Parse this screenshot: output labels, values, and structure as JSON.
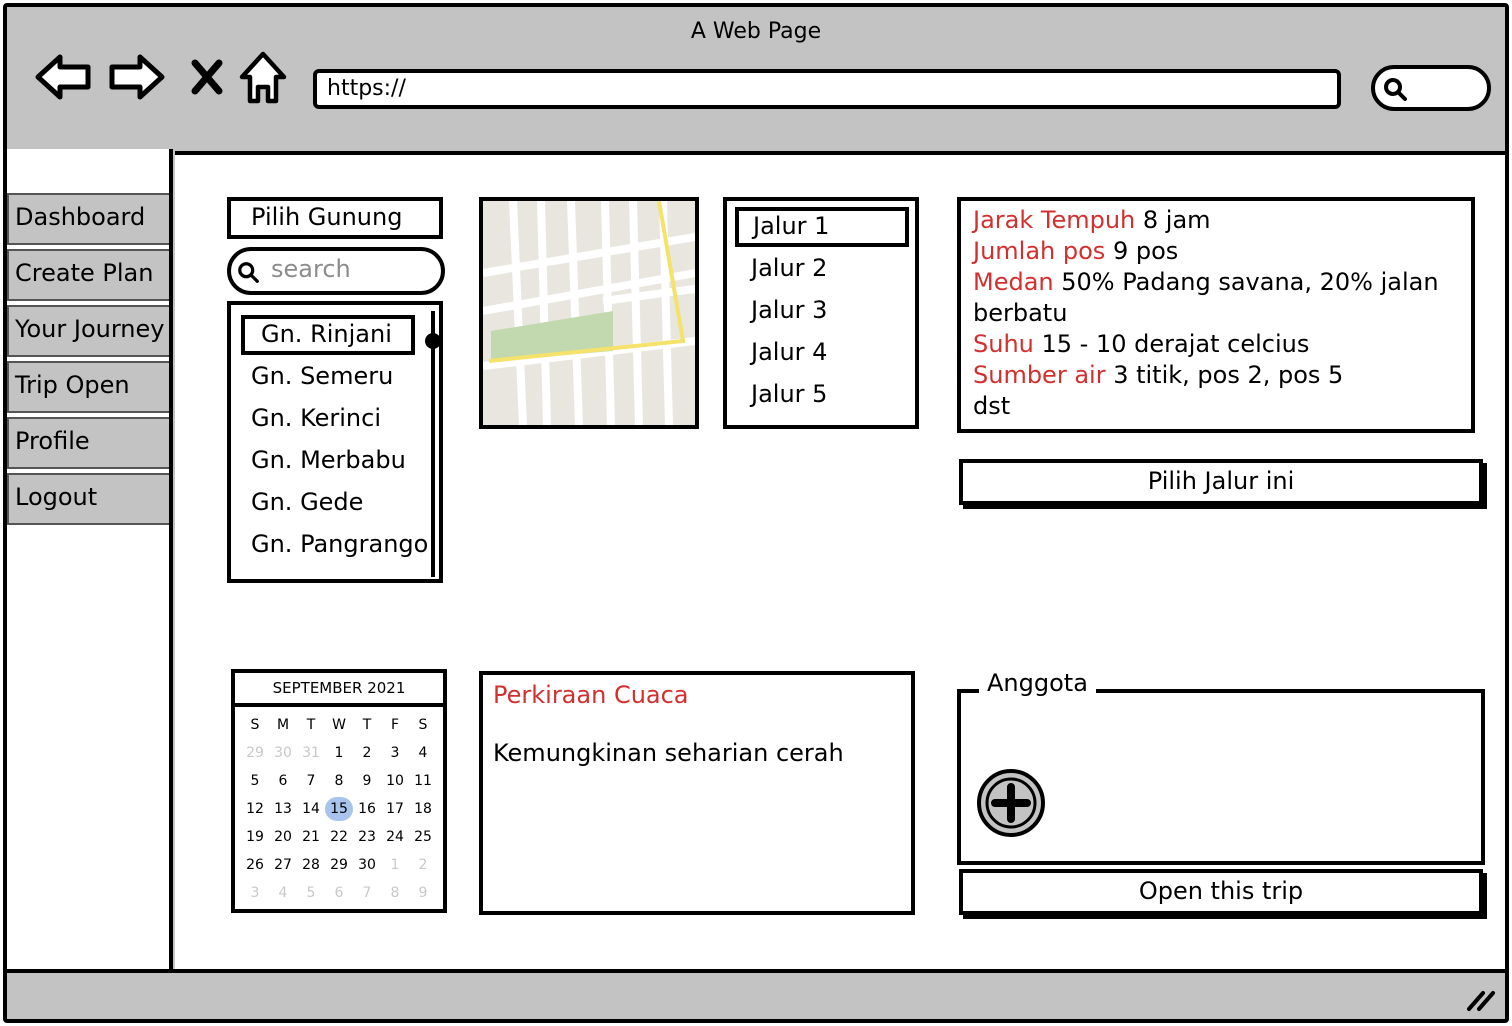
{
  "window": {
    "title": "A Web Page"
  },
  "toolbar": {
    "url": "https://"
  },
  "sidebar": {
    "items": [
      {
        "label": "Dashboard"
      },
      {
        "label": "Create Plan"
      },
      {
        "label": "Your Journey"
      },
      {
        "label": "Trip Open"
      },
      {
        "label": "Profile"
      },
      {
        "label": "Logout"
      }
    ]
  },
  "mountain_panel": {
    "select_label": "Pilih Gunung",
    "search_placeholder": "search",
    "items": [
      "Gn. Rinjani",
      "Gn. Semeru",
      "Gn. Kerinci",
      "Gn. Merbabu",
      "Gn. Gede",
      "Gn. Pangrango"
    ],
    "selected": "Gn. Rinjani"
  },
  "route_panel": {
    "items": [
      "Jalur 1",
      "Jalur 2",
      "Jalur 3",
      "Jalur 4",
      "Jalur 5"
    ],
    "selected": "Jalur 1"
  },
  "route_info": {
    "lines": [
      {
        "label": "Jarak Tempuh",
        "value": " 8 jam"
      },
      {
        "label": "Jumlah pos",
        "value": " 9 pos"
      },
      {
        "label": "Medan",
        "value": " 50% Padang savana, 20% jalan berbatu"
      },
      {
        "label": "Suhu",
        "value": " 15 - 10 derajat celcius"
      },
      {
        "label": "Sumber air",
        "value": " 3 titik, pos 2, pos 5"
      },
      {
        "label": "",
        "value": "dst"
      }
    ],
    "select_button": "Pilih Jalur ini"
  },
  "calendar": {
    "month": "SEPTEMBER 2021",
    "weekdays": [
      "S",
      "M",
      "T",
      "W",
      "T",
      "F",
      "S"
    ],
    "days": [
      {
        "d": "29",
        "dim": true
      },
      {
        "d": "30",
        "dim": true
      },
      {
        "d": "31",
        "dim": true
      },
      {
        "d": "1"
      },
      {
        "d": "2"
      },
      {
        "d": "3"
      },
      {
        "d": "4"
      },
      {
        "d": "5"
      },
      {
        "d": "6"
      },
      {
        "d": "7"
      },
      {
        "d": "8"
      },
      {
        "d": "9"
      },
      {
        "d": "10"
      },
      {
        "d": "11"
      },
      {
        "d": "12"
      },
      {
        "d": "13"
      },
      {
        "d": "14"
      },
      {
        "d": "15",
        "today": true
      },
      {
        "d": "16"
      },
      {
        "d": "17"
      },
      {
        "d": "18"
      },
      {
        "d": "19"
      },
      {
        "d": "20"
      },
      {
        "d": "21"
      },
      {
        "d": "22"
      },
      {
        "d": "23"
      },
      {
        "d": "24"
      },
      {
        "d": "25"
      },
      {
        "d": "26"
      },
      {
        "d": "27"
      },
      {
        "d": "28"
      },
      {
        "d": "29"
      },
      {
        "d": "30"
      },
      {
        "d": "1",
        "dim": true
      },
      {
        "d": "2",
        "dim": true
      },
      {
        "d": "3",
        "dim": true
      },
      {
        "d": "4",
        "dim": true
      },
      {
        "d": "5",
        "dim": true
      },
      {
        "d": "6",
        "dim": true
      },
      {
        "d": "7",
        "dim": true
      },
      {
        "d": "8",
        "dim": true
      },
      {
        "d": "9",
        "dim": true
      }
    ]
  },
  "weather": {
    "title": "Perkiraan Cuaca",
    "text": "Kemungkinan seharian cerah"
  },
  "members": {
    "title": "Anggota",
    "open_button": "Open this trip"
  },
  "colors": {
    "chrome": "#c3c3c3",
    "accent_red": "#d32f2f",
    "today_highlight": "#a9c4ec",
    "map_green": "#c2d9b0",
    "map_road_yellow": "#f5e26b"
  },
  "icons": {
    "back": "arrow-left-icon",
    "forward": "arrow-right-icon",
    "stop": "close-icon",
    "home": "home-icon",
    "search": "search-icon",
    "add": "plus-circle-icon",
    "resize": "resize-grip-icon"
  }
}
